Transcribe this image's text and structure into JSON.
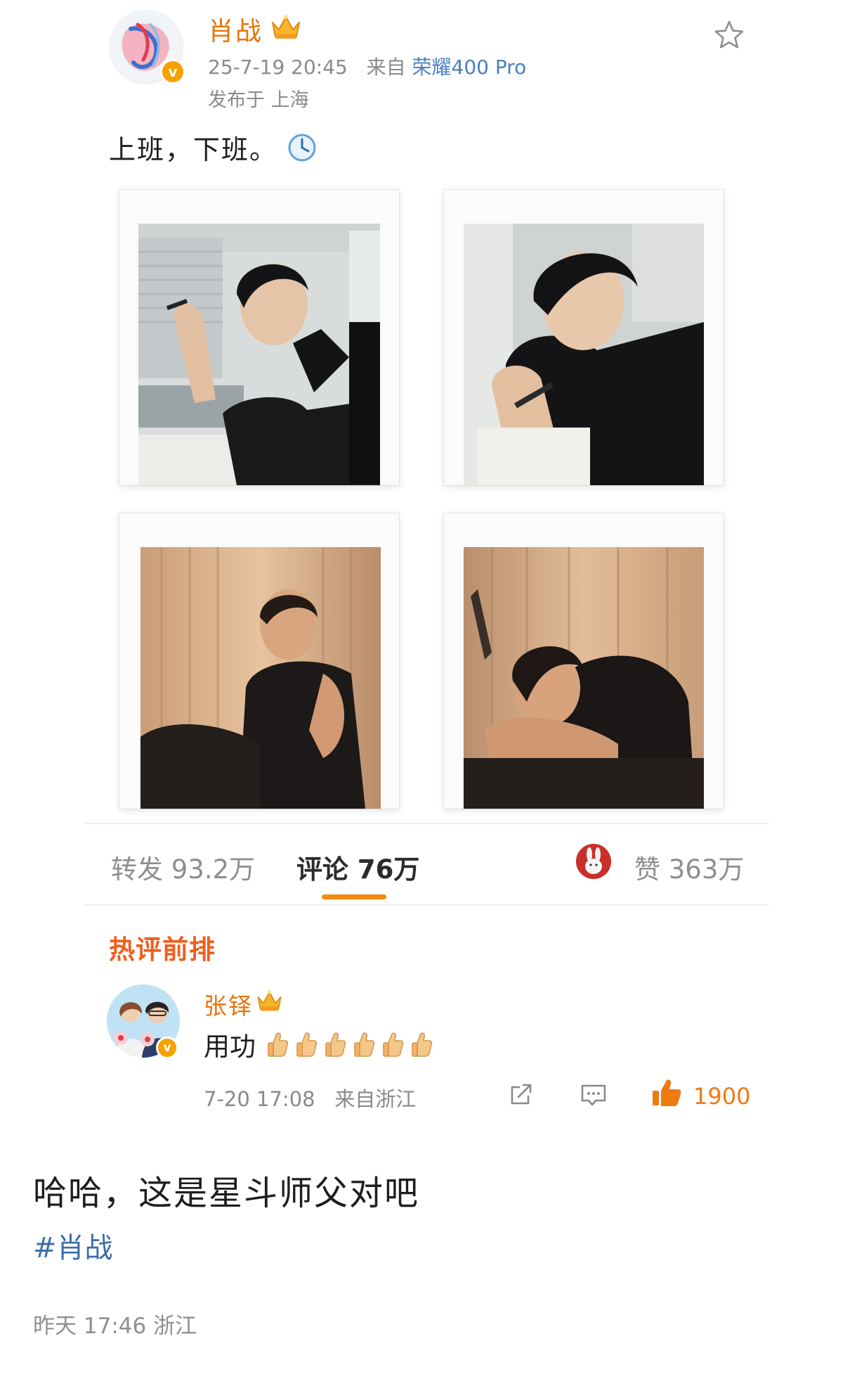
{
  "post": {
    "author": "肖战",
    "date": "25-7-19 20:45",
    "source_prefix": "来自",
    "device": "荣耀400 Pro",
    "location": "发布于 上海",
    "text": "上班，下班。",
    "clock_icon": "clock-emoji-icon"
  },
  "stats": {
    "repost": "转发 93.2万",
    "comments": "评论 76万",
    "likes": "赞 363万"
  },
  "hot_comments": {
    "title": "热评前排",
    "author": "张铎",
    "text": "用功",
    "thumbs_count": 6,
    "date": "7-20 17:08",
    "source": "来自浙江",
    "like_count": "1900"
  },
  "outer": {
    "text": "哈哈，这是星斗师父对吧",
    "hashtag": "#肖战",
    "meta": "昨天 17:46 浙江"
  },
  "colors": {
    "accent_orange": "#f28a0f",
    "author_orange": "#e8740c",
    "link_blue": "#4a7fc2",
    "hot_title": "#ef5e1e"
  }
}
